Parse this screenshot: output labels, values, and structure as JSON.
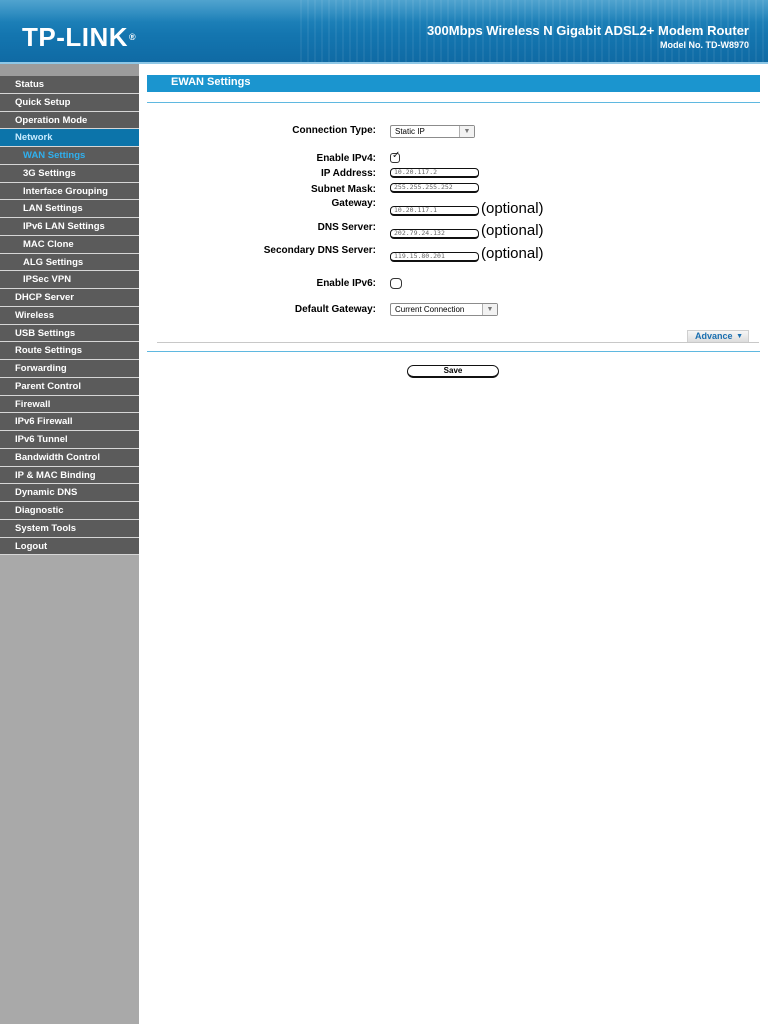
{
  "header": {
    "logo": "TP-LINK",
    "logo_mark": "®",
    "product": "300Mbps Wireless N Gigabit ADSL2+ Modem Router",
    "model": "Model No. TD-W8970"
  },
  "sidebar": {
    "items": [
      {
        "label": "Status"
      },
      {
        "label": "Quick Setup"
      },
      {
        "label": "Operation Mode"
      },
      {
        "label": "Network"
      },
      {
        "label": "WAN Settings"
      },
      {
        "label": "3G Settings"
      },
      {
        "label": "Interface Grouping"
      },
      {
        "label": "LAN Settings"
      },
      {
        "label": "IPv6 LAN Settings"
      },
      {
        "label": "MAC Clone"
      },
      {
        "label": "ALG Settings"
      },
      {
        "label": "IPSec VPN"
      },
      {
        "label": "DHCP Server"
      },
      {
        "label": "Wireless"
      },
      {
        "label": "USB Settings"
      },
      {
        "label": "Route Settings"
      },
      {
        "label": "Forwarding"
      },
      {
        "label": "Parent Control"
      },
      {
        "label": "Firewall"
      },
      {
        "label": "IPv6 Firewall"
      },
      {
        "label": "IPv6 Tunnel"
      },
      {
        "label": "Bandwidth Control"
      },
      {
        "label": "IP & MAC Binding"
      },
      {
        "label": "Dynamic DNS"
      },
      {
        "label": "Diagnostic"
      },
      {
        "label": "System Tools"
      },
      {
        "label": "Logout"
      }
    ]
  },
  "main": {
    "title": "EWAN Settings",
    "connection_type": {
      "label": "Connection Type:",
      "value": "Static IP"
    },
    "enable_ipv4": {
      "label": "Enable IPv4:",
      "checked": true
    },
    "ip_address": {
      "label": "IP Address:",
      "value": "10.20.117.2"
    },
    "subnet_mask": {
      "label": "Subnet Mask:",
      "value": "255.255.255.252"
    },
    "gateway": {
      "label": "Gateway:",
      "value": "10.20.117.1",
      "note": "(optional)"
    },
    "dns_server": {
      "label": "DNS Server:",
      "value": "202.79.24.132",
      "note": "(optional)"
    },
    "secondary_dns": {
      "label": "Secondary DNS Server:",
      "value": "119.15.80.201",
      "note": "(optional)"
    },
    "enable_ipv6": {
      "label": "Enable IPv6:",
      "checked": false
    },
    "default_gateway": {
      "label": "Default Gateway:",
      "value": "Current Connection"
    },
    "advance_label": "Advance",
    "save_label": "Save"
  },
  "colors": {
    "header_blue": "#1476b0",
    "title_blue": "#1b95cf",
    "menu_gray": "#5b5b5b",
    "menu_active": "#0c74aa",
    "menu_current_text": "#2fb0ef",
    "sidebar_gray": "#a9a9a9"
  }
}
